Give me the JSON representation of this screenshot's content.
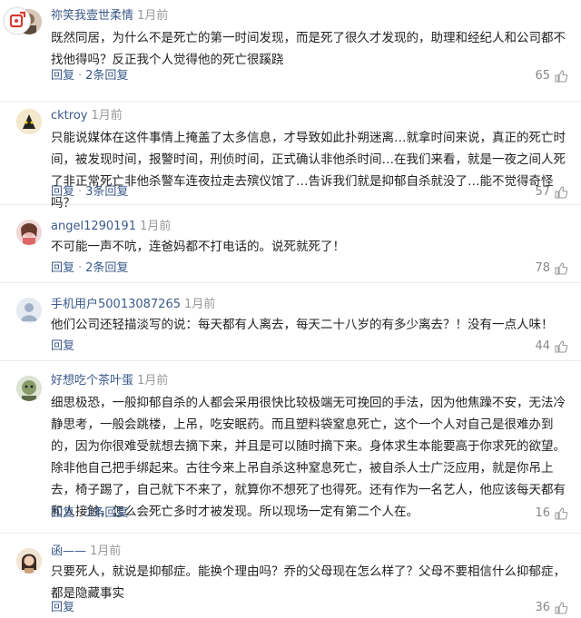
{
  "comments": [
    {
      "user": "祢笑我壹世柔情",
      "time": "1月前",
      "text": "既然同居，为什么不是死亡的第一时间发现，而是死了很久才发现的，助理和经纪人和公司都不找他得吗？反正我个人觉得他的死亡很蹊跷",
      "reply": "回复",
      "reply_count": "2条回复",
      "likes": "65"
    },
    {
      "user": "cktroy",
      "time": "1月前",
      "text": "只能说媒体在这件事情上掩盖了太多信息，才导致如此扑朔迷离…就拿时间来说，真正的死亡时间，被发现时间，报警时间，刑侦时间，正式确认非他杀时间…在我们来看，就是一夜之间人死了非正常死亡非他杀警车连夜拉走去殡仪馆了…告诉我们就是抑郁自杀就没了…能不觉得奇怪吗？",
      "reply": "回复",
      "reply_count": "3条回复",
      "likes": "57"
    },
    {
      "user": "angel1290191",
      "time": "1月前",
      "text": "不可能一声不吭，连爸妈都不打电话的。说死就死了！",
      "reply": "回复",
      "reply_count": "2条回复",
      "likes": "78"
    },
    {
      "user": "手机用户50013087265",
      "time": "1月前",
      "text": "他们公司还轻描淡写的说：每天都有人离去，每天二十八岁的有多少离去？！没有一点人味！",
      "reply": "回复",
      "reply_count": "",
      "likes": "44"
    },
    {
      "user": "好想吃个茶叶蛋",
      "time": "1月前",
      "text": "细思极恐，一般抑郁自杀的人都会采用很快比较极端无可挽回的手法，因为他焦躁不安，无法冷静思考，一般会跳楼，上吊，吃安眠药。而且塑料袋窒息死亡，这个一个人对自己是很难办到的，因为你很难受就想去摘下来，并且是可以随时摘下来。身体求生本能要高于你求死的欲望。除非他自己把手绑起来。古往今来上吊自杀这种窒息死亡，被自杀人士广泛应用，就是你吊上去，椅子踢了，自己就下不来了，就算你不想死了也得死。还有作为一名艺人，他应该每天都有和人接触，怎么会死亡多时才被发现。所以现场一定有第二个人在。",
      "reply": "回复",
      "reply_count": "1条回复",
      "likes": "16"
    },
    {
      "user": "函——",
      "time": "1月前",
      "text": "只要死人，就说是抑郁症。能换个理由吗？乔的父母现在怎么样了？父母不要相信什么抑郁症，都是隐藏事实",
      "reply": "回复",
      "reply_count": "",
      "likes": "36"
    }
  ],
  "separator": "·",
  "colors": {
    "username": "#3b5a8a",
    "meta": "#999999",
    "text": "#222222"
  },
  "icons": {
    "like": "thumbs-up-icon",
    "brand": "app-logo-icon"
  }
}
